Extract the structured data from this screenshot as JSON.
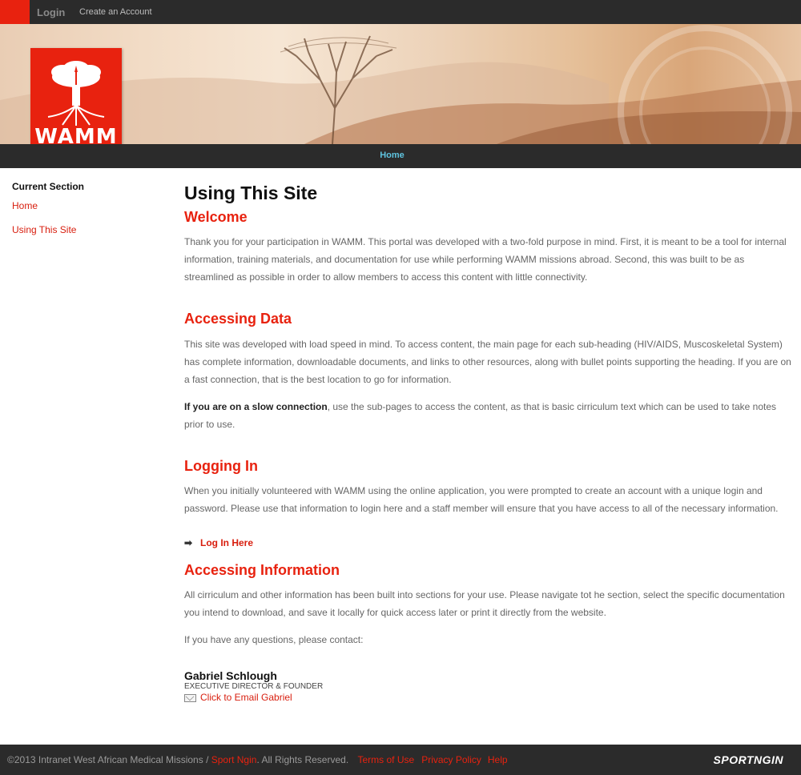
{
  "topbar": {
    "login": "Login",
    "create_account": "Create an Account"
  },
  "logo": {
    "text": "WAMM"
  },
  "nav": {
    "home": "Home"
  },
  "sidebar": {
    "heading": "Current Section",
    "items": [
      {
        "label": "Home"
      },
      {
        "label": "Using This Site"
      }
    ]
  },
  "main": {
    "title": "Using This Site",
    "welcome": {
      "heading": "Welcome",
      "text": "Thank you for your participation in WAMM. This portal was developed with a two-fold purpose in mind. First, it is meant to be a tool for internal information, training materials, and  documentation for use while performing WAMM missions abroad. Second, this was built to be as streamlined as possible in order to allow members to access this content with little connectivity."
    },
    "accessing_data": {
      "heading": "Accessing Data",
      "text1": "This site was developed with load speed in mind. To access content, the main page for each sub-heading (HIV/AIDS, Muscoskeletal System) has complete information, downloadable documents, and links to other resources, along with bullet points supporting the heading. If you are on a fast connection, that is the best location to go for information.",
      "text2_bold": "If you are on a slow connection",
      "text2_rest": ", use the sub-pages to access the content, as that is basic cirriculum text which can be used to take notes prior to use."
    },
    "logging_in": {
      "heading": "Logging In",
      "text": "When you initially volunteered with WAMM using the online application, you were prompted to create an account with a unique login and password. Please use that information to login here and a staff member will ensure that you have access to all of the necessary information.",
      "link": "Log In Here"
    },
    "accessing_info": {
      "heading": "Accessing Information",
      "text": "All cirriculum and other information has been built into sections for your use. Please navigate tot he section, select the specific documentation you intend to download, and save it locally for quick access later or print it directly from the website.",
      "questions": "If you have any questions, please contact:"
    },
    "contact": {
      "name": "Gabriel Schlough",
      "role": "EXECUTIVE DIRECTOR & FOUNDER",
      "email_link": "Click to Email Gabriel"
    }
  },
  "footer": {
    "copyright": "©2013 Intranet West African Medical Missions / ",
    "sportngin_link": "Sport Ngin",
    "rights": ". All Rights Reserved.",
    "terms": "Terms of Use",
    "privacy": "Privacy Policy",
    "help": "Help",
    "brand": "SPORTNGIN"
  },
  "colors": {
    "accent_red": "#e8220f",
    "dark_bar": "#2b2b2b",
    "nav_link": "#5fc4e0"
  }
}
